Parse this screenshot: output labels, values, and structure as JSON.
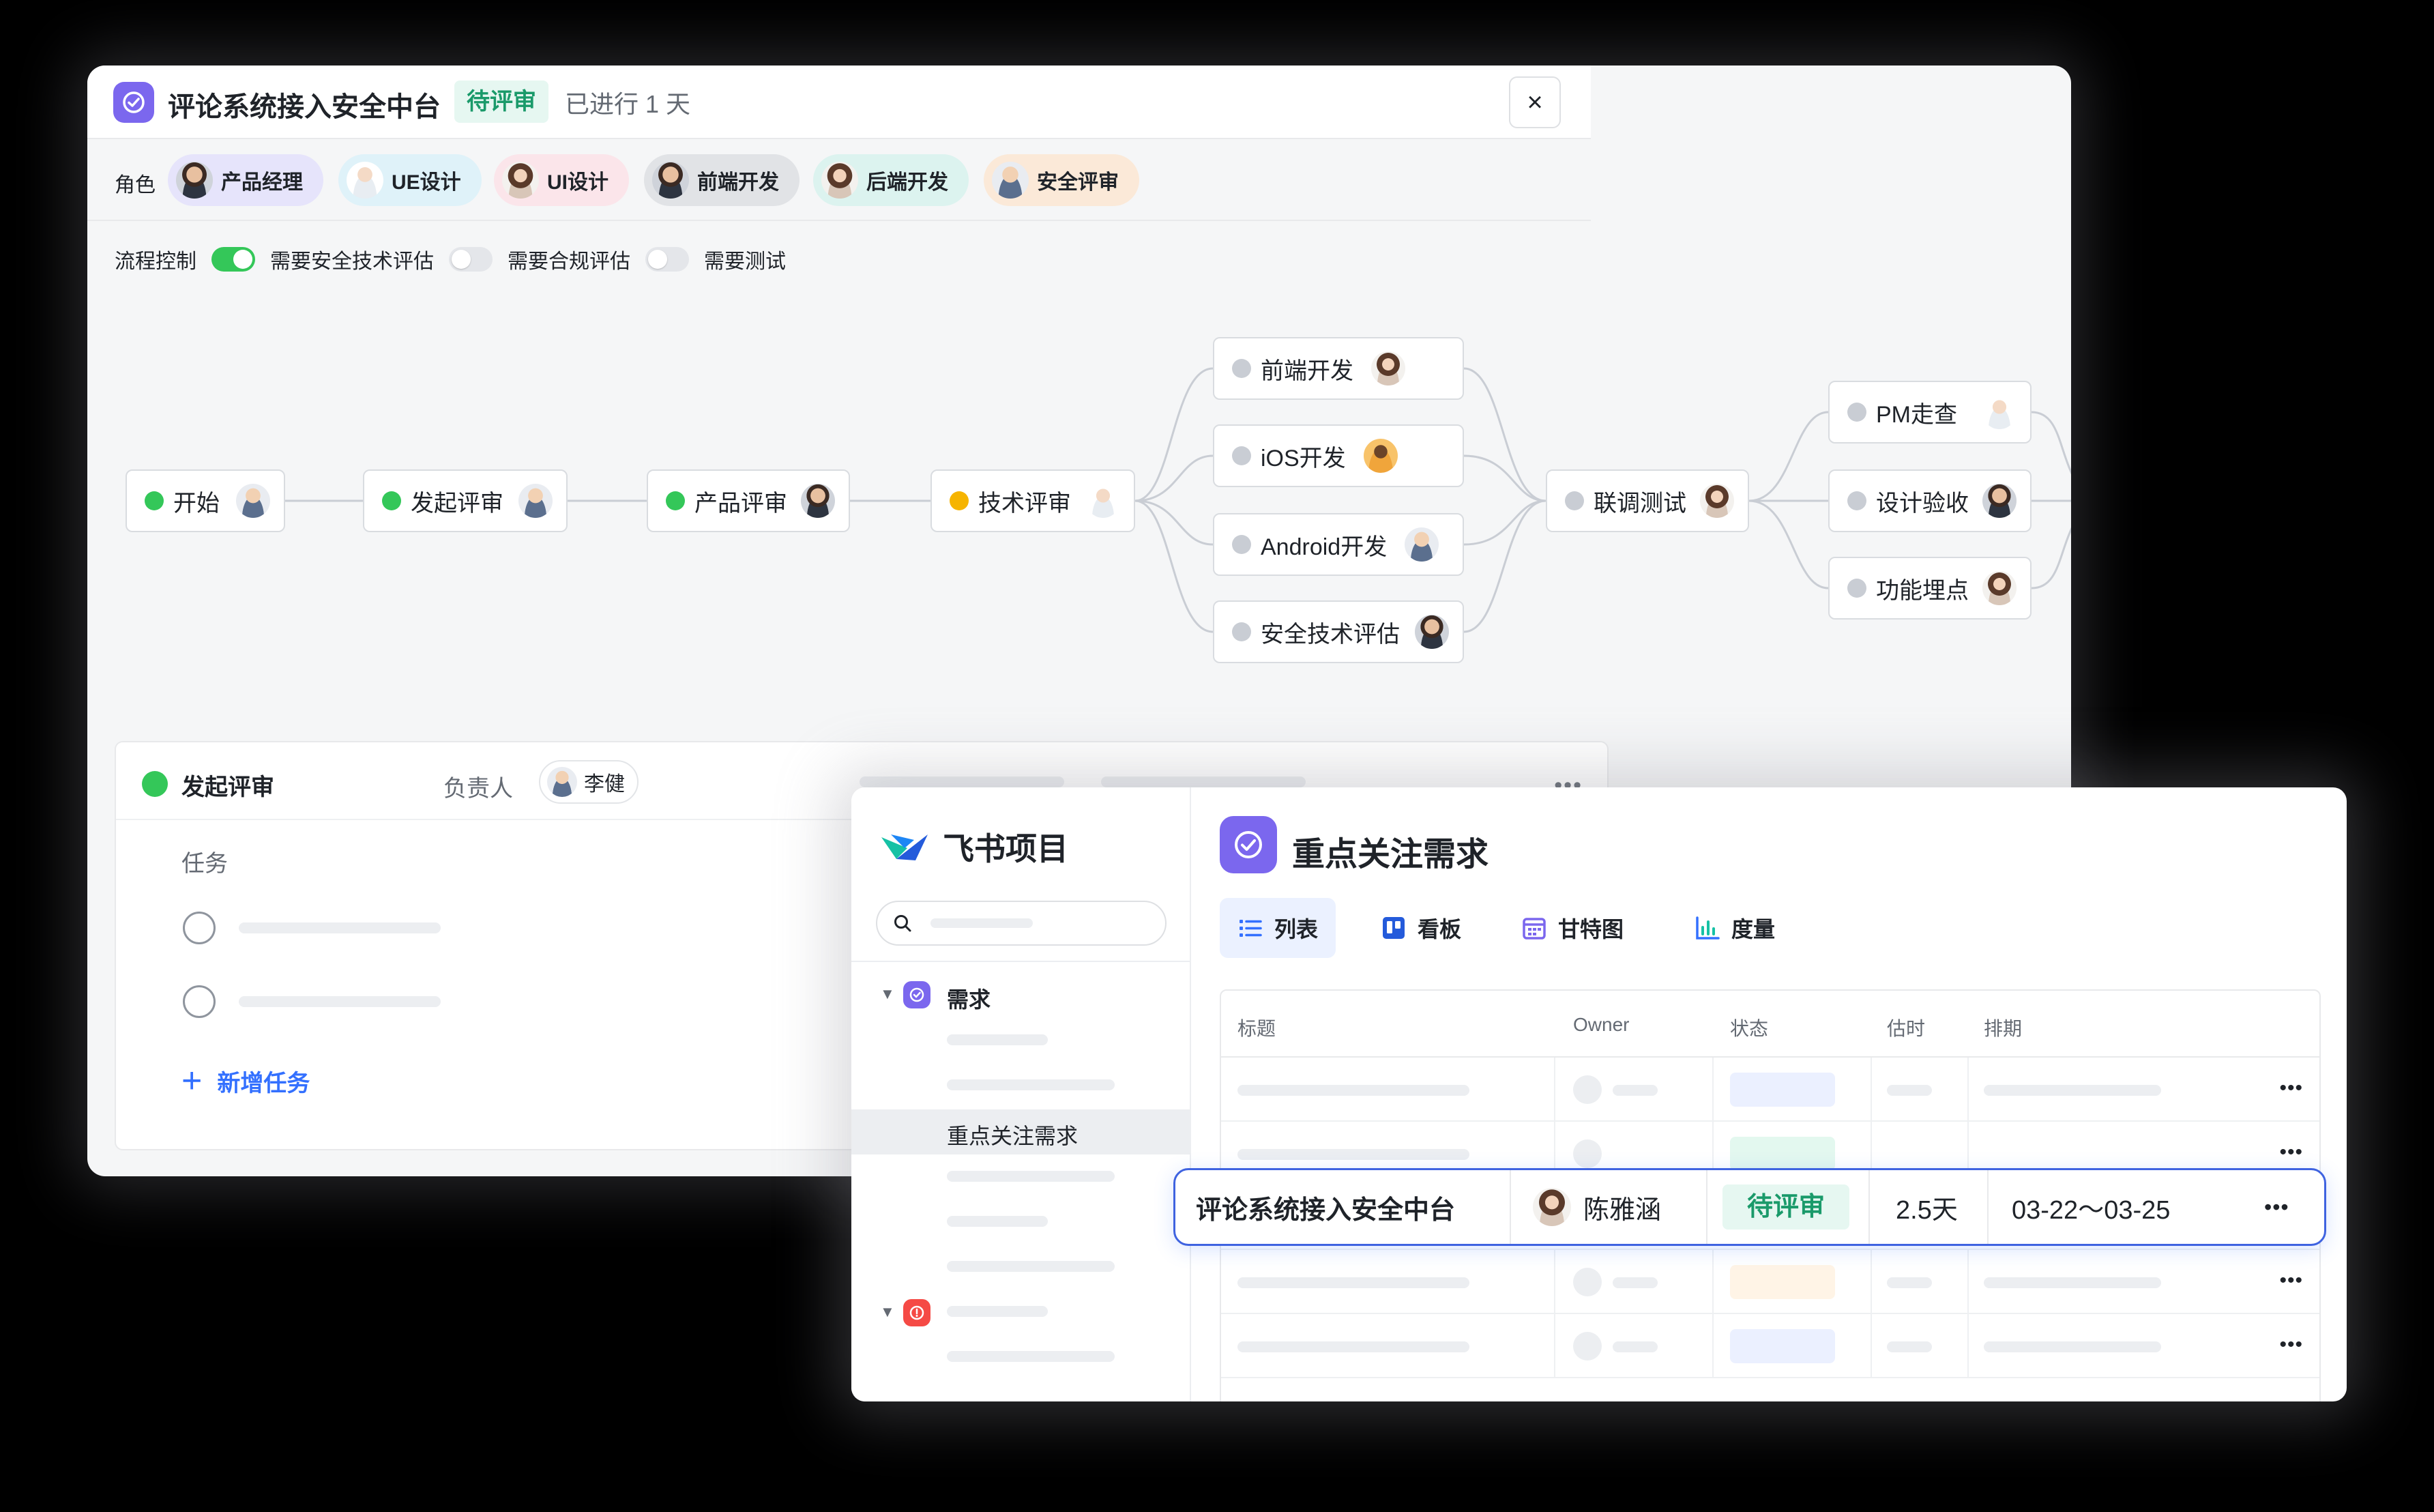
{
  "review": {
    "title": "评论系统接入安全中台",
    "status": "待评审",
    "elapsed": "已进行 1 天",
    "close": "×"
  },
  "roles": {
    "label": "角色",
    "items": [
      {
        "label": "产品经理",
        "bg": "#e6e4fb"
      },
      {
        "label": "UE设计",
        "bg": "#dff2f9"
      },
      {
        "label": "UI设计",
        "bg": "#fbe5ea"
      },
      {
        "label": "前端开发",
        "bg": "#e1e3e6"
      },
      {
        "label": "后端开发",
        "bg": "#dcf3ef"
      },
      {
        "label": "安全评审",
        "bg": "#fbe9d8"
      }
    ]
  },
  "flow_control": {
    "label": "流程控制",
    "options": [
      {
        "label": "需要安全技术评估",
        "on": true
      },
      {
        "label": "需要合规评估",
        "on": false
      },
      {
        "label": "需要测试",
        "on": false
      }
    ]
  },
  "flow": {
    "nodes": [
      {
        "id": "start",
        "label": "开始",
        "status": "done"
      },
      {
        "id": "initiate",
        "label": "发起评审",
        "status": "done"
      },
      {
        "id": "product",
        "label": "产品评审",
        "status": "done"
      },
      {
        "id": "tech",
        "label": "技术评审",
        "status": "in-progress"
      },
      {
        "id": "frontend",
        "label": "前端开发",
        "status": "pending"
      },
      {
        "id": "ios",
        "label": "iOS开发",
        "status": "pending"
      },
      {
        "id": "android",
        "label": "Android开发",
        "status": "pending"
      },
      {
        "id": "security",
        "label": "安全技术评估",
        "status": "pending"
      },
      {
        "id": "integration",
        "label": "联调测试",
        "status": "pending"
      },
      {
        "id": "pm",
        "label": "PM走查",
        "status": "pending"
      },
      {
        "id": "design",
        "label": "设计验收",
        "status": "pending"
      },
      {
        "id": "tracking",
        "label": "功能埋点",
        "status": "pending"
      }
    ]
  },
  "task_panel": {
    "title": "发起评审",
    "owner_label": "负责人",
    "owner_name": "李健",
    "tasks_label": "任务",
    "add_task": "新增任务",
    "more": "•••"
  },
  "front": {
    "brand": "飞书项目",
    "search_placeholder": "",
    "tree": {
      "group1": "需求",
      "selected": "重点关注需求"
    },
    "title": "重点关注需求",
    "tabs": [
      {
        "label": "列表",
        "icon": "list-icon",
        "active": true
      },
      {
        "label": "看板",
        "icon": "kanban-icon",
        "active": false
      },
      {
        "label": "甘特图",
        "icon": "gantt-icon",
        "active": false
      },
      {
        "label": "度量",
        "icon": "chart-icon",
        "active": false
      }
    ],
    "columns": [
      "标题",
      "Owner",
      "状态",
      "估时",
      "排期"
    ],
    "highlight_row": {
      "title": "评论系统接入安全中台",
      "owner": "陈雅涵",
      "status": "待评审",
      "estimate": "2.5天",
      "schedule": "03-22～03-25",
      "more": "•••"
    },
    "row_more": "•••"
  },
  "colors": {
    "accent_purple": "#7b67ee",
    "status_green": "#1a9a6a",
    "status_green_bg": "#e6f7f1",
    "link_blue": "#3370ff",
    "highlight_border": "#3f63e0"
  }
}
